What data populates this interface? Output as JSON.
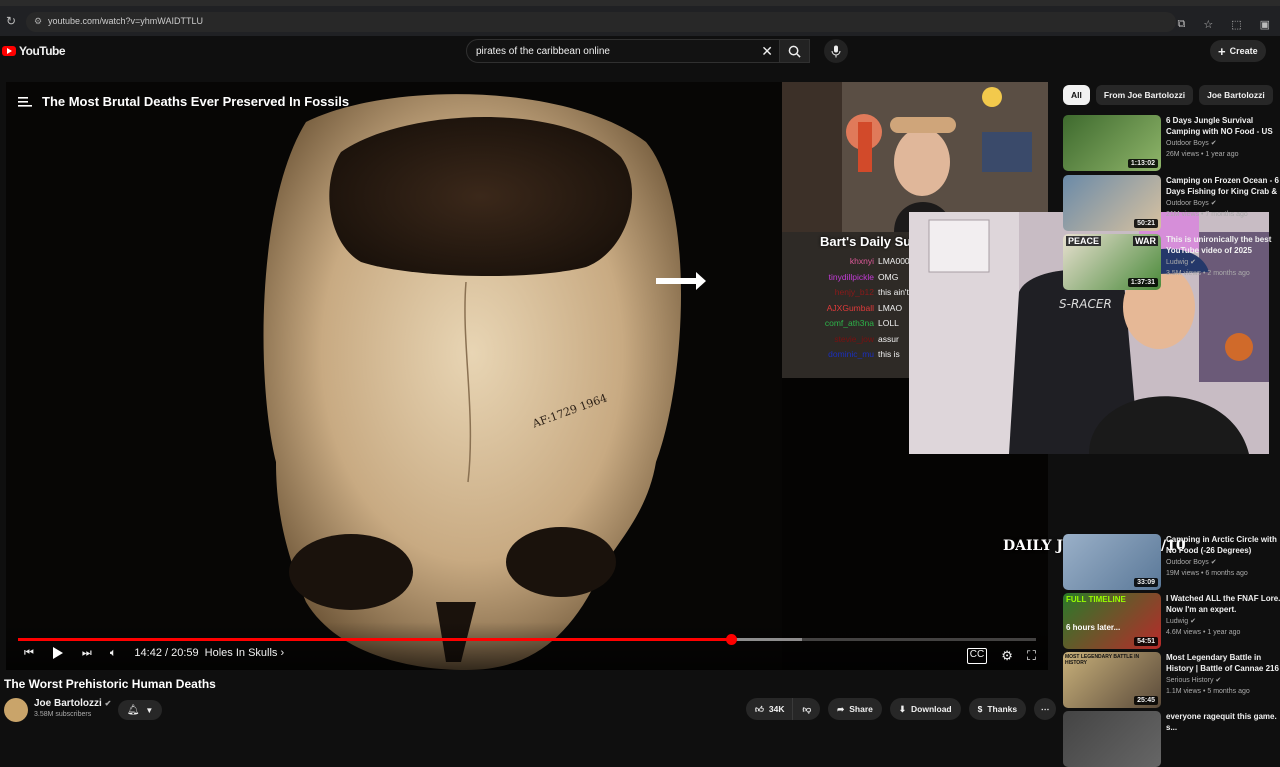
{
  "browser": {
    "url": "youtube.com/watch?v=yhmWAIDTTLU"
  },
  "header": {
    "logo": "YouTube",
    "search_value": "pirates of the caribbean online",
    "create_label": "Create"
  },
  "player": {
    "overlay_title": "The Most Brutal Deaths Ever Preserved In Fossils",
    "time": "14:42 / 20:59",
    "chapter": "Holes In Skulls ›",
    "progress_fraction": 0.7,
    "buffered_fraction": 0.77,
    "skull_ink": "AF:1729 1964"
  },
  "stream": {
    "sub_goal": "Bart's Daily Sub Goal 236/75",
    "chat": [
      {
        "user": "khxnyi",
        "msg": "LMA00000000",
        "color": "#e05a9a"
      },
      {
        "user": "tinydillpickle",
        "msg": "OMG",
        "color": "#c23bd6"
      },
      {
        "user": "henjy_b12",
        "msg": "this ain't that deep",
        "color": "#8b1a1a"
      },
      {
        "user": "AJXGumball",
        "msg": "LMAO",
        "color": "#e03a3a"
      },
      {
        "user": "comf_ath3na",
        "msg": "LOLL",
        "color": "#2db34a"
      },
      {
        "user": "stevie_jow",
        "msg": "assur",
        "color": "#7a1010"
      },
      {
        "user": "dominic_mu",
        "msg": "this is",
        "color": "#1a2fbf"
      }
    ],
    "overlay_caption": "DAILY JOHNSONS 0/10"
  },
  "video": {
    "title": "The Worst Prehistoric Human Deaths",
    "channel": "Joe Bartolozzi",
    "subscribers": "3.58M subscribers"
  },
  "actions": {
    "likes": "34K",
    "share": "Share",
    "download": "Download",
    "thanks": "Thanks"
  },
  "chips": [
    "All",
    "From Joe Bartolozzi",
    "Joe Bartolozzi"
  ],
  "recommendations": [
    {
      "title": "6 Days Jungle Survival Camping with NO Food - US Marine Cor...",
      "channel": "Outdoor Boys",
      "views": "26M views • 1 year ago",
      "duration": "1:13:02"
    },
    {
      "title": "Camping on Frozen Ocean - 6 Days Fishing for King Crab & ...",
      "channel": "Outdoor Boys",
      "views": "21M views • 7 months ago",
      "duration": "50:21"
    },
    {
      "title": "This is unironically the best YouTube video of 2025",
      "channel": "Ludwig",
      "views": "3.5M views • 2 months ago",
      "duration": "1:37:31"
    },
    {
      "title": "Camping in Arctic Circle with No Food (-26 Degrees)",
      "channel": "Outdoor Boys",
      "views": "19M views • 6 months ago",
      "duration": "33:09"
    },
    {
      "title": "I Watched ALL the FNAF Lore. Now I'm an expert.",
      "channel": "Ludwig",
      "views": "4.6M views • 1 year ago",
      "duration": "54:51"
    },
    {
      "title": "Most Legendary Battle in History | Battle of Cannae 216 ...",
      "channel": "Serious History",
      "views": "1.1M views • 5 months ago",
      "duration": "25:45"
    },
    {
      "title": "everyone ragequit this game. s...",
      "channel": "",
      "views": "",
      "duration": ""
    }
  ],
  "thumb_labels": {
    "peace": "PEACE",
    "war": "WAR",
    "full_timeline": "FULL TIMELINE",
    "six_hours": "6 hours later...",
    "cannae": "MOST LEGENDARY BATTLE IN HISTORY"
  }
}
